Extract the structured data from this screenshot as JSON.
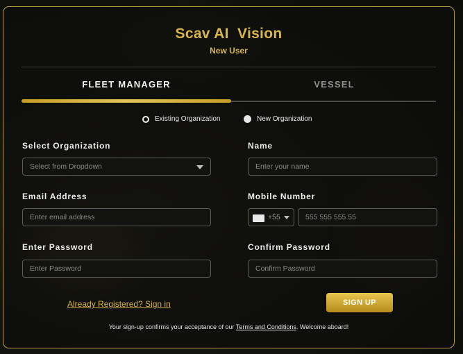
{
  "header": {
    "title": "Scav AI  Vision",
    "subtitle": "New User"
  },
  "tabs": [
    {
      "label": "FLEET MANAGER",
      "active": true
    },
    {
      "label": "VESSEL",
      "active": false
    }
  ],
  "org_type": {
    "options": [
      {
        "label": "Existing Organization",
        "selected": false
      },
      {
        "label": "New Organization",
        "selected": true
      }
    ]
  },
  "form": {
    "select_org": {
      "label": "Select Organization",
      "placeholder": "Select from Dropdown"
    },
    "name": {
      "label": "Name",
      "placeholder": "Enter your name"
    },
    "email": {
      "label": "Email Address",
      "placeholder": "Enter email address"
    },
    "mobile": {
      "label": "Mobile Number",
      "country_code": "+55",
      "placeholder": "555 555 555 55"
    },
    "password": {
      "label": "Enter Password",
      "placeholder": "Enter Password"
    },
    "confirm_password": {
      "label": "Confirm Password",
      "placeholder": "Confirm Password"
    }
  },
  "actions": {
    "signin_link": "Already Registered? Sign in",
    "signup_button": "SIGN UP"
  },
  "footer": {
    "prefix": "Your sign-up confirms your acceptance of our ",
    "terms_link": "Terms and Conditions",
    "suffix": ". Welcome aboard!"
  },
  "colors": {
    "accent": "#d9b648",
    "border": "#b39a3e",
    "background": "#0b0b09"
  }
}
